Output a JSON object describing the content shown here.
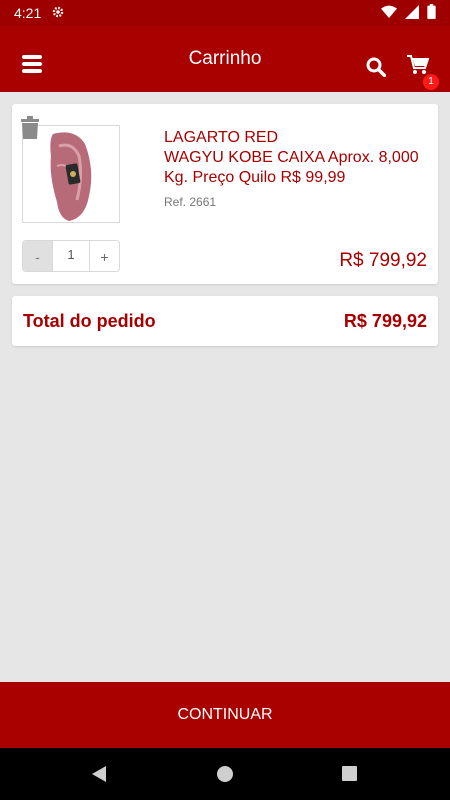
{
  "status": {
    "time": "4:21"
  },
  "header": {
    "title": "Carrinho",
    "cart_badge": "1"
  },
  "item": {
    "name_line1": "LAGARTO RED",
    "name_line2": "WAGYU KOBE CAIXA Aprox. 8,000 Kg. Preço Quilo R$ 99,99",
    "ref": "Ref. 2661",
    "quantity": "1",
    "minus_label": "-",
    "plus_label": "+",
    "price": "R$ 799,92"
  },
  "total": {
    "label": "Total do pedido",
    "value": "R$ 799,92"
  },
  "footer": {
    "continue_label": "CONTINUAR"
  },
  "colors": {
    "brand": "#a90000",
    "accent_text": "#a70000",
    "background": "#e6e6e6"
  },
  "icons": [
    "settings-icon",
    "wifi-icon",
    "signal-icon",
    "battery-icon",
    "menu-icon",
    "search-icon",
    "cart-icon",
    "trash-icon",
    "back-icon",
    "home-icon",
    "recents-icon"
  ]
}
